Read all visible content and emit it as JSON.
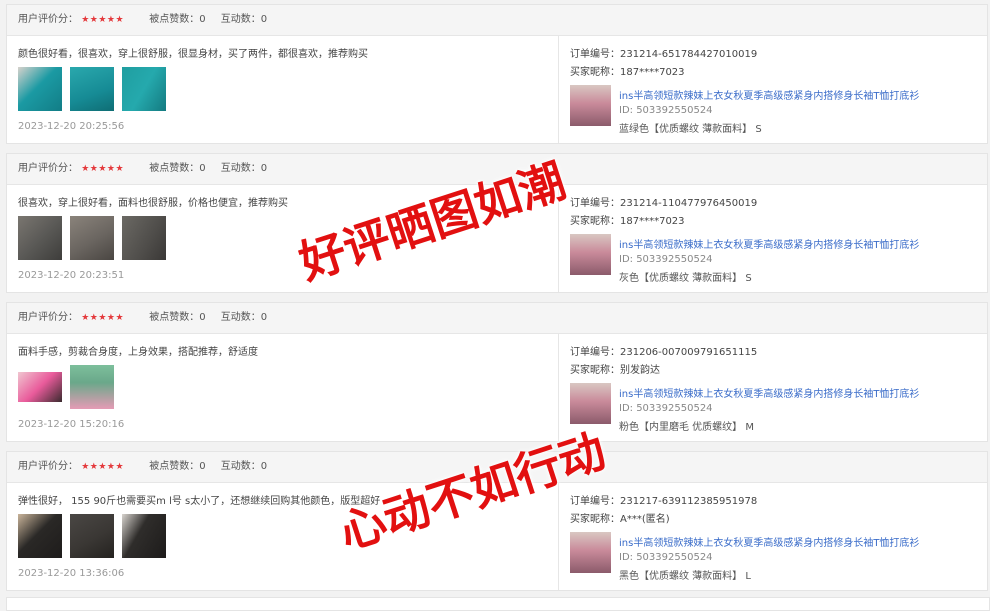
{
  "labels": {
    "rating": "用户评价分：",
    "likes_prefix": "被点赞数：",
    "interactions_prefix": "互动数：",
    "order_prefix": "订单编号：",
    "buyer_prefix": "买家昵称："
  },
  "reviews": [
    {
      "stars": "★★★★★",
      "likes": "被点赞数：0",
      "interactions": "互动数：0",
      "text": "颜色很好看，很喜欢，穿上很舒服，很显身材，买了两件，都很喜欢，推荐购买",
      "time": "2023-12-20 20:25:56",
      "order": "订单编号：231214-651784427010019",
      "buyer": "买家昵称：187****7023",
      "product_title": "ins半高领短款辣妹上衣女秋夏季高级感紧身内搭修身长袖T恤打底衫",
      "product_id": "ID: 503392550524",
      "spec": "蓝绿色【优质螺纹 薄款面料】 S",
      "thumb_colors": [
        "#1b9aa3",
        "#168b95",
        "#1f9ea0"
      ]
    },
    {
      "stars": "★★★★★",
      "likes": "被点赞数：0",
      "interactions": "互动数：0",
      "text": "很喜欢，穿上很好看，面料也很舒服，价格也便宜，推荐购买",
      "time": "2023-12-20 20:23:51",
      "order": "订单编号：231214-110477976450019",
      "buyer": "买家昵称：187****7023",
      "product_title": "ins半高领短款辣妹上衣女秋夏季高级感紧身内搭修身长袖T恤打底衫",
      "product_id": "ID: 503392550524",
      "spec": "灰色【优质螺纹 薄款面料】 S",
      "thumb_colors": [
        "#5b5a57",
        "#6a6560",
        "#4f4d4a"
      ]
    },
    {
      "stars": "★★★★★",
      "likes": "被点赞数：0",
      "interactions": "互动数：0",
      "text": "面料手感，剪裁合身度，上身效果，搭配推荐，舒适度",
      "time": "2023-12-20 15:20:16",
      "order": "订单编号：231206-007009791651115",
      "buyer": "买家昵称：别发韵达",
      "product_title": "ins半高领短款辣妹上衣女秋夏季高级感紧身内搭修身长袖T恤打底衫",
      "product_id": "ID: 503392550524",
      "spec": "粉色【内里磨毛 优质螺纹】 M",
      "thumb_colors": [
        "#e95b9b",
        "#6aa88a"
      ]
    },
    {
      "stars": "★★★★★",
      "likes": "被点赞数：0",
      "interactions": "互动数：0",
      "text": "弹性很好， 155 90斤也需要买m l号 s太小了，还想继续回购其他颜色，版型超好",
      "time": "2023-12-20 13:36:06",
      "order": "订单编号：231217-639112385951978",
      "buyer": "买家昵称：A***(匿名)",
      "product_title": "ins半高领短款辣妹上衣女秋夏季高级感紧身内搭修身长袖T恤打底衫",
      "product_id": "ID: 503392550524",
      "spec": "黑色【优质螺纹 薄款面料】 L",
      "thumb_colors": [
        "#2a2826",
        "#3a3734",
        "#2f2d2b"
      ]
    }
  ],
  "watermarks": [
    "好评晒图如潮",
    "心动不如行动"
  ]
}
